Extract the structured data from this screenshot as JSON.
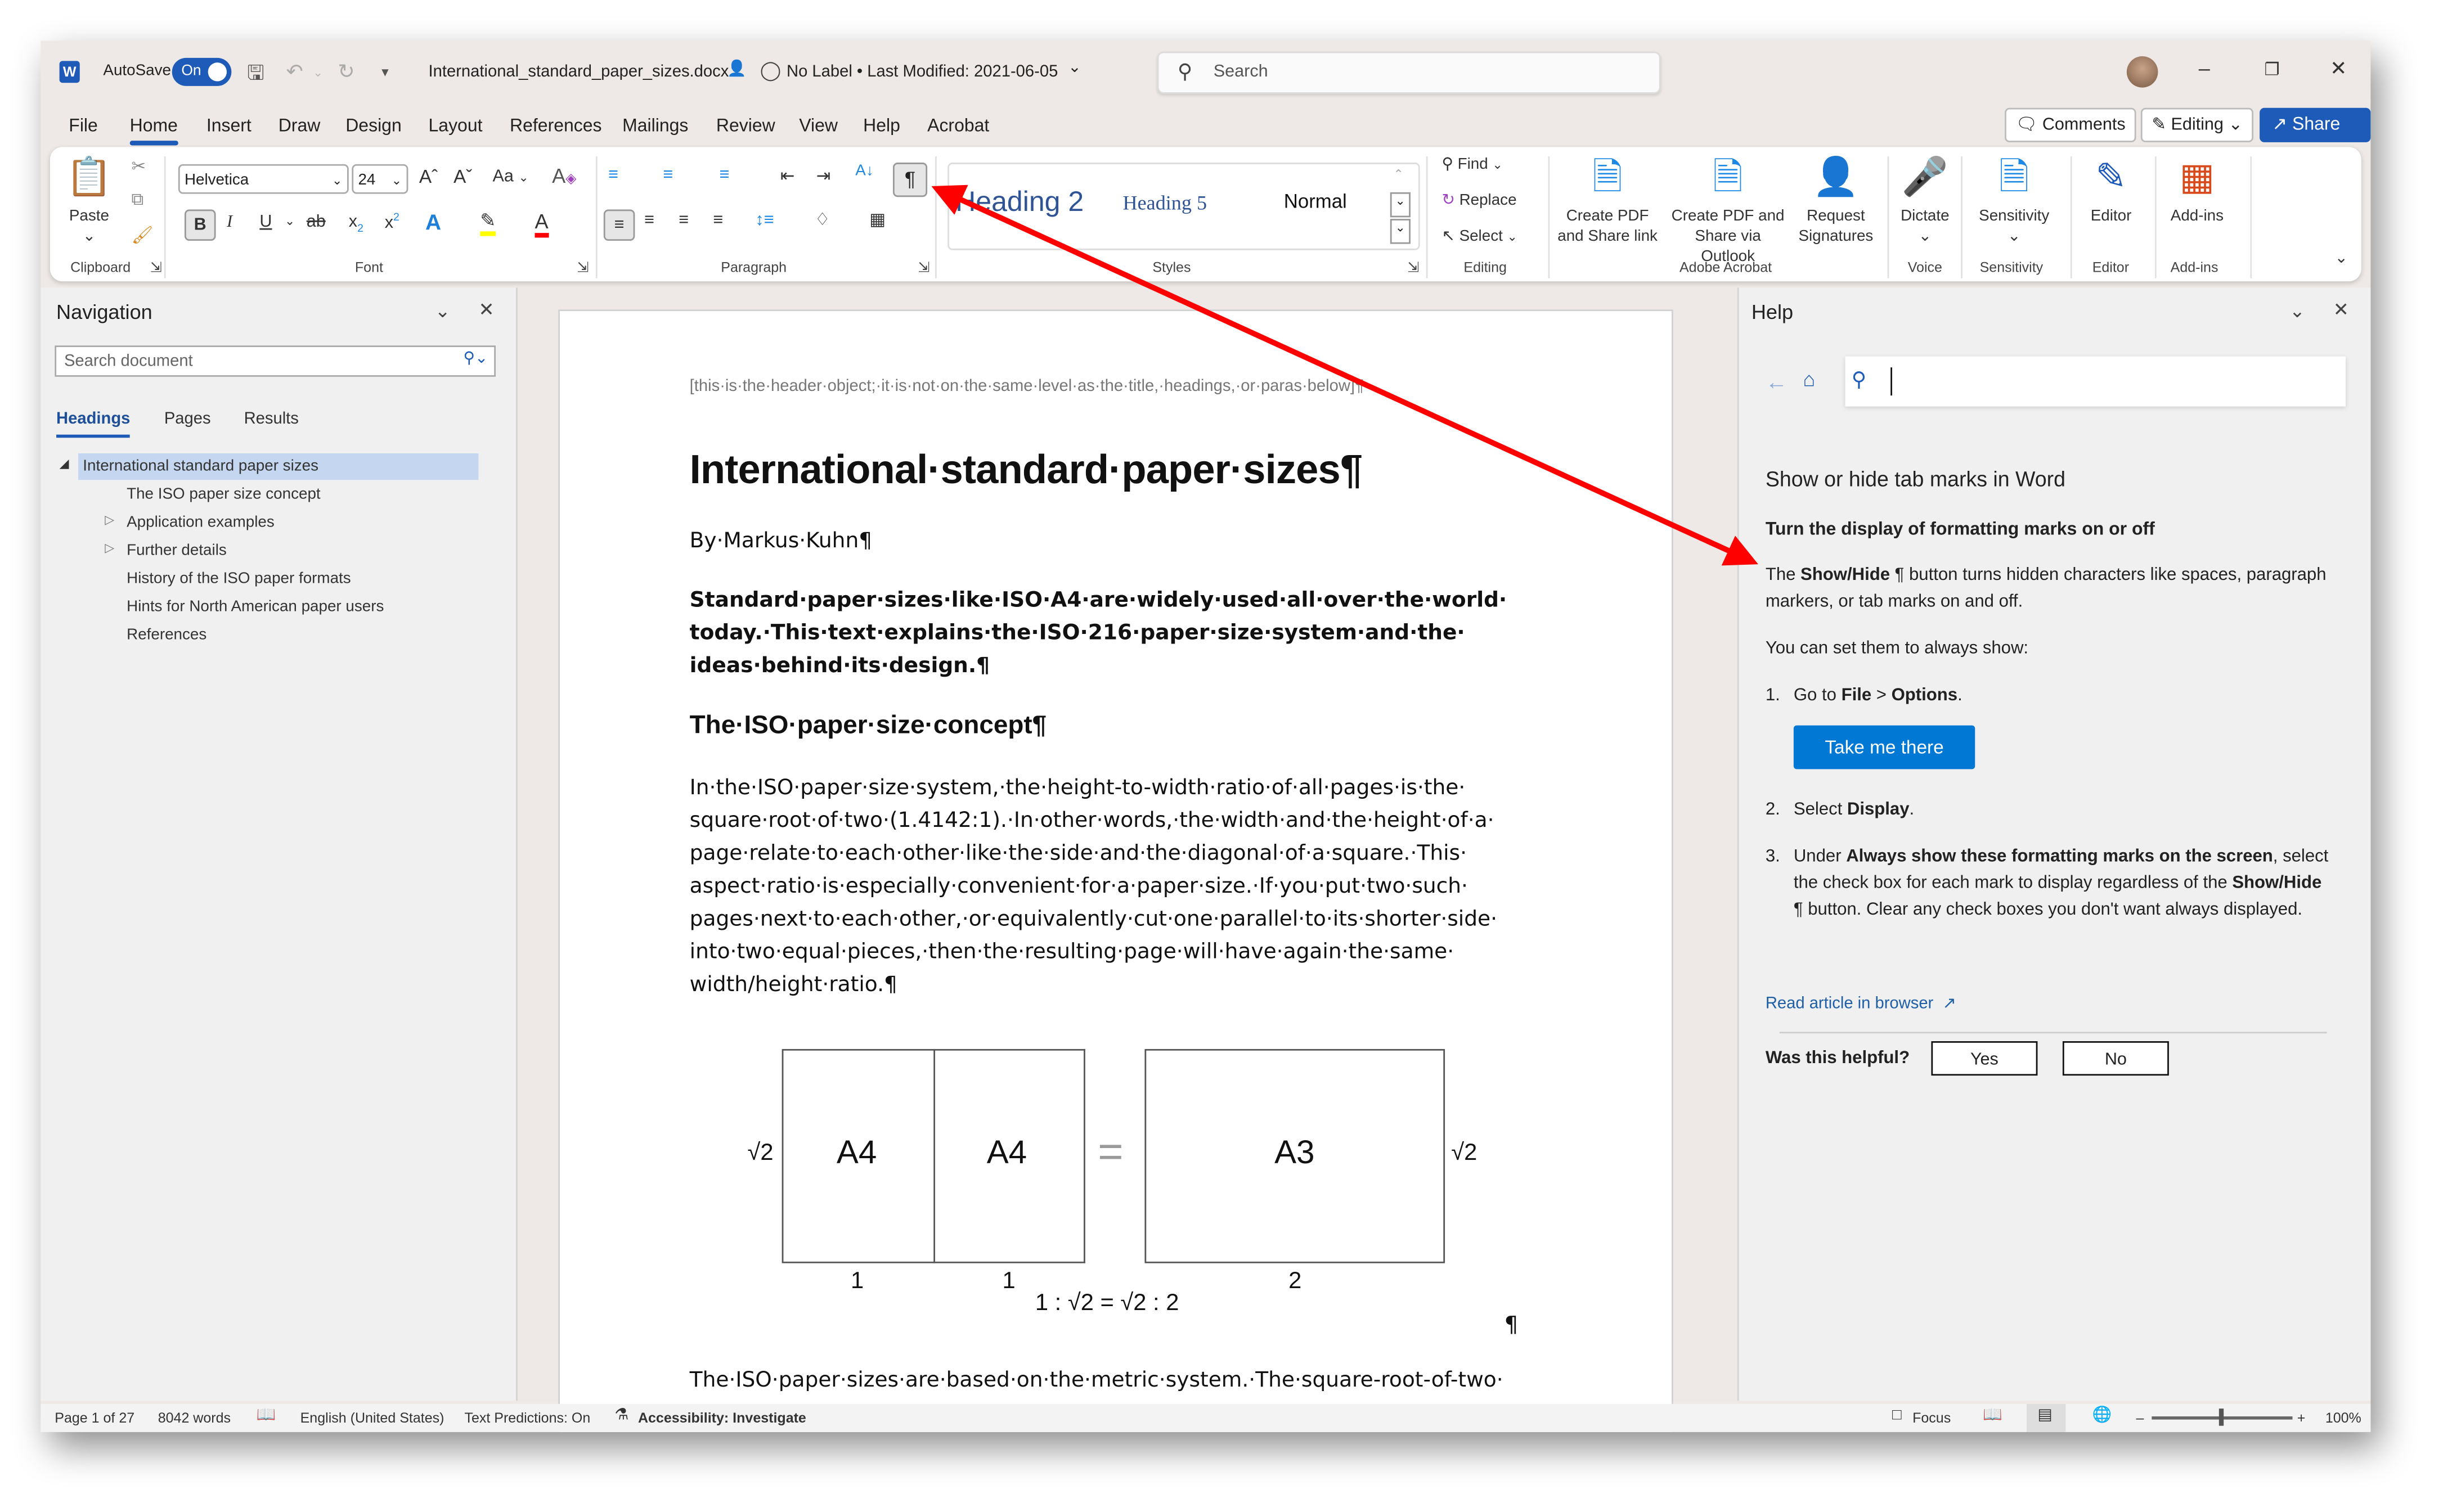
{
  "titlebar": {
    "app_icon": "word-logo-icon",
    "autosave_label": "AutoSave",
    "autosave_state": "On",
    "filename": "International_standard_paper_sizes.docx",
    "label_info": "No Label • Last Modified: 2021-06-05",
    "search_placeholder": "Search",
    "window_controls": [
      "minimize",
      "restore",
      "close"
    ]
  },
  "tabs": [
    "File",
    "Home",
    "Insert",
    "Draw",
    "Design",
    "Layout",
    "References",
    "Mailings",
    "Review",
    "View",
    "Help",
    "Acrobat"
  ],
  "active_tab": "Home",
  "top_buttons": {
    "comments": "Comments",
    "editing": "Editing",
    "share": "Share"
  },
  "ribbon": {
    "clipboard": {
      "paste": "Paste",
      "group": "Clipboard"
    },
    "font": {
      "name": "Helvetica",
      "size": "24",
      "case_label": "Aa",
      "group": "Font"
    },
    "paragraph": {
      "group": "Paragraph",
      "show_hide_active": true
    },
    "styles": {
      "items": [
        "Heading 2",
        "Heading 5",
        "Normal"
      ],
      "group": "Styles"
    },
    "editing": {
      "find": "Find",
      "replace": "Replace",
      "select": "Select",
      "group": "Editing"
    },
    "acrobat": {
      "create_pdf_link": [
        "Create PDF",
        "and Share link"
      ],
      "create_pdf_outlook": [
        "Create PDF and",
        "Share via Outlook"
      ],
      "request_sig": [
        "Request",
        "Signatures"
      ],
      "group": "Adobe Acrobat"
    },
    "voice": {
      "dictate": "Dictate",
      "group": "Voice"
    },
    "sensitivity": {
      "label": "Sensitivity",
      "group": "Sensitivity"
    },
    "editor": {
      "label": "Editor",
      "group": "Editor"
    },
    "addins": {
      "label": "Add-ins",
      "group": "Add-ins"
    }
  },
  "navigation": {
    "title": "Navigation",
    "search_placeholder": "Search document",
    "tabs": [
      "Headings",
      "Pages",
      "Results"
    ],
    "active_tab": "Headings",
    "headings": [
      {
        "text": "International standard paper sizes",
        "level": 1,
        "selected": true,
        "expander": "expanded"
      },
      {
        "text": "The ISO paper size concept",
        "level": 2,
        "expander": "none"
      },
      {
        "text": "Application examples",
        "level": 2,
        "expander": "collapsed"
      },
      {
        "text": "Further details",
        "level": 2,
        "expander": "collapsed"
      },
      {
        "text": "History of the ISO paper formats",
        "level": 2,
        "expander": "none"
      },
      {
        "text": "Hints for North American paper users",
        "level": 2,
        "expander": "none"
      },
      {
        "text": "References",
        "level": 2,
        "expander": "none"
      }
    ]
  },
  "document": {
    "header": "[this·is·the·header·object;·it·is·not·on·the·same·level·as·the·title,·headings,·or·paras·below]¶",
    "title": "International·standard·paper·sizes¶",
    "byline": "By·Markus·Kuhn¶",
    "lead_lines": [
      "Standard·paper·sizes·like·ISO·A4·are·widely·used·all·over·the·world·",
      "today.·This·text·explains·the·ISO·216·paper·size·system·and·the·",
      "ideas·behind·its·design.¶"
    ],
    "heading2": "The·ISO·paper·size·concept¶",
    "body_lines": [
      "In·the·ISO·paper·size·system,·the·height-to-width·ratio·of·all·pages·is·the·",
      "square·root·of·two·(1.4142:1).·In·other·words,·the·width·and·the·height·of·a·",
      "page·relate·to·each·other·like·the·side·and·the·diagonal·of·a·square.·This·",
      "aspect·ratio·is·especially·convenient·for·a·paper·size.·If·you·put·two·such·",
      "pages·next·to·each·other,·or·equivalently·cut·one·parallel·to·its·shorter·side·",
      "into·two·equal·pieces,·then·the·resulting·page·will·have·again·the·same·",
      "width/height·ratio.¶"
    ],
    "figure": {
      "left_height": "√2",
      "right_height": "√2",
      "sheet1": "A4",
      "sheet2": "A4",
      "equals": "=",
      "sheet3": "A3",
      "w1": "1",
      "w2": "1",
      "w3": "2",
      "ratio": "1 : √2 = √2 : 2",
      "para_mark": "¶"
    },
    "body2": "The·ISO·paper·sizes·are·based·on·the·metric·system.·The·square-root-of-two·"
  },
  "help": {
    "title": "Help",
    "article_title": "Show or hide tab marks in Word",
    "subtitle": "Turn the display of formatting marks on or off",
    "p1_pre": "The ",
    "p1_bold": "Show/Hide",
    "p1_post": " button turns hidden characters like spaces, paragraph markers, or tab marks on and off.",
    "p2": "You can set them to always show:",
    "step1_pre": "Go to ",
    "step1_b1": "File",
    "step1_mid": " > ",
    "step1_b2": "Options",
    "step1_end": ".",
    "take_me_there": "Take me there",
    "step2_pre": "Select ",
    "step2_bold": "Display",
    "step2_end": ".",
    "step3_pre": "Under ",
    "step3_bold": "Always show these formatting marks on the screen",
    "step3_mid": ", select the check box for each mark to display regardless of the ",
    "step3_bold2": "Show/Hide",
    "step3_post": " button. Clear any check boxes you don't want always displayed.",
    "read_in_browser": "Read article in browser",
    "helpful_q": "Was this helpful?",
    "yes": "Yes",
    "no": "No"
  },
  "status": {
    "page": "Page 1 of 27",
    "words": "8042 words",
    "language": "English (United States)",
    "predictions": "Text Predictions: On",
    "accessibility": "Accessibility: Investigate",
    "focus": "Focus",
    "zoom": "100%",
    "zoom_level_percent": 100
  },
  "annotation": {
    "arrow_color": "#ff0000",
    "from": "show-hide-button",
    "to": "help-show-hide-text"
  },
  "colors": {
    "accent": "#1e5bb8",
    "help_button": "#0078d4",
    "selected_heading": "#c5d6f0"
  }
}
